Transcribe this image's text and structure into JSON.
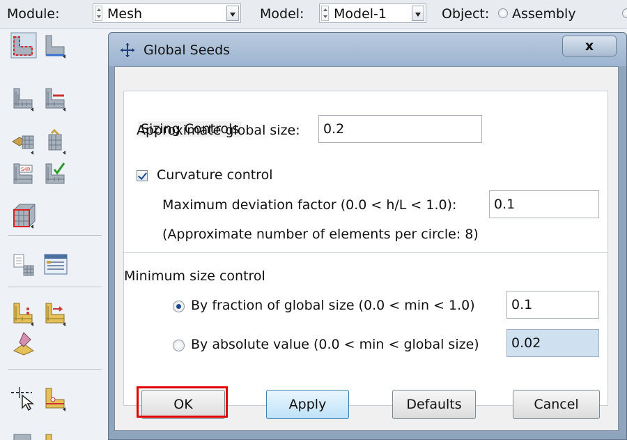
{
  "topbar": {
    "module_label": "Module:",
    "module_value": "Mesh",
    "model_label": "Model:",
    "model_value": "Model-1",
    "object_label": "Object:",
    "object_option": "Assembly"
  },
  "toolbox": {
    "icons": [
      "seed-part-icon",
      "seed-edges-icon",
      "delete-part-seeds-icon",
      "delete-edge-seeds-icon",
      "assign-mesh-controls-icon",
      "assign-stack-direction-icon",
      "assign-element-type-icon",
      "verify-mesh-icon",
      "mesh-region-icon",
      "create-mesh-part-icon",
      "query-info-icon",
      "edit-mesh-icon",
      "edit-mesh-nodes-icon",
      "erase-mesh-icon",
      "select-tool-icon",
      "partition-tool-icon"
    ]
  },
  "dialog": {
    "title": "Global Seeds",
    "close_label": "x",
    "sizing_heading": "Sizing Controls",
    "approx_label": "Approximate global size:",
    "approx_value": "0.2",
    "curvature_label": "Curvature control",
    "curvature_checked": true,
    "deviation_label": "Maximum deviation factor (0.0 < h/L < 1.0):",
    "deviation_value": "0.1",
    "elements_note": "(Approximate number of elements per circle: 8)",
    "min_size_heading": "Minimum size control",
    "fraction_label": "By fraction of global size  (0.0 < min < 1.0)",
    "fraction_value": "0.1",
    "fraction_selected": true,
    "absolute_label": "By absolute value  (0.0 < min < global size)",
    "absolute_value": "0.02",
    "ok_label": "OK",
    "apply_label": "Apply",
    "defaults_label": "Defaults",
    "cancel_label": "Cancel"
  },
  "colors": {
    "highlight": "#e00000",
    "dialog_frame": "#8fa5be",
    "disabled_field": "#cfe0f0"
  }
}
